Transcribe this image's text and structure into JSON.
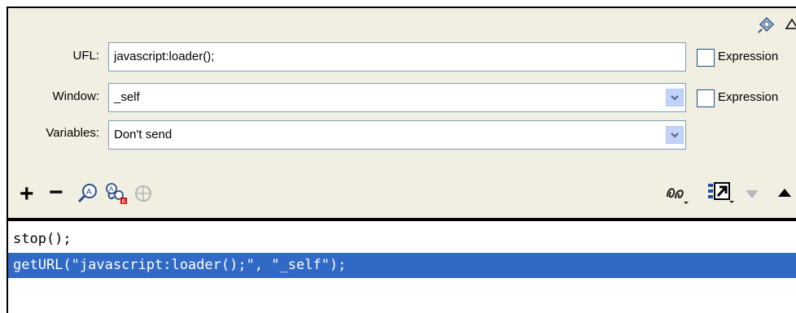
{
  "form": {
    "url_label": "UFL:",
    "url_value": "javascript:loader();",
    "window_label": "Window:",
    "window_value": "_self",
    "variables_label": "Variables:",
    "variables_value": "Don't send",
    "expression_label": "Expression"
  },
  "toolbar": {
    "add": "+",
    "remove": "−"
  },
  "code": {
    "lines": [
      "stop();",
      "getURL(\"javascript:loader();\", \"_self\");"
    ],
    "selected_line": 1
  },
  "colors": {
    "panel_bg": "#f1efe2",
    "selection": "#3169c6",
    "field_border": "#7f9db9"
  }
}
